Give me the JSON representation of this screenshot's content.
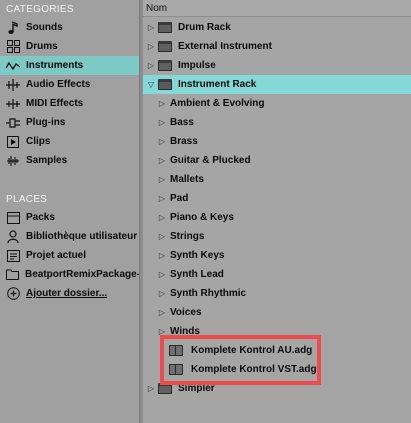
{
  "sidebar": {
    "categories_title": "CATEGORIES",
    "categories": [
      {
        "label": "Sounds",
        "icon": "note-icon"
      },
      {
        "label": "Drums",
        "icon": "grid-icon"
      },
      {
        "label": "Instruments",
        "icon": "wave-icon",
        "selected": true
      },
      {
        "label": "Audio Effects",
        "icon": "audio-effect-icon"
      },
      {
        "label": "MIDI Effects",
        "icon": "midi-effect-icon"
      },
      {
        "label": "Plug-ins",
        "icon": "plug-icon"
      },
      {
        "label": "Clips",
        "icon": "clip-icon"
      },
      {
        "label": "Samples",
        "icon": "sample-wave-icon"
      }
    ],
    "places_title": "PLACES",
    "places": [
      {
        "label": "Packs",
        "icon": "box-icon"
      },
      {
        "label": "Bibliothèque utilisateur",
        "icon": "user-icon"
      },
      {
        "label": "Projet actuel",
        "icon": "project-icon"
      },
      {
        "label": "BeatportRemixPackage-",
        "icon": "folder-icon"
      },
      {
        "label": "Ajouter dossier...",
        "icon": "add-icon"
      }
    ]
  },
  "browser": {
    "column_header": "Nom",
    "items": [
      {
        "label": "Drum Rack",
        "level": 0,
        "type": "folder",
        "expanded": false
      },
      {
        "label": "External Instrument",
        "level": 0,
        "type": "folder",
        "expanded": false
      },
      {
        "label": "Impulse",
        "level": 0,
        "type": "folder",
        "expanded": false
      },
      {
        "label": "Instrument Rack",
        "level": 0,
        "type": "folder",
        "expanded": true,
        "selected": true
      },
      {
        "label": "Ambient & Evolving",
        "level": 1,
        "type": "category"
      },
      {
        "label": "Bass",
        "level": 1,
        "type": "category"
      },
      {
        "label": "Brass",
        "level": 1,
        "type": "category"
      },
      {
        "label": "Guitar & Plucked",
        "level": 1,
        "type": "category"
      },
      {
        "label": "Mallets",
        "level": 1,
        "type": "category"
      },
      {
        "label": "Pad",
        "level": 1,
        "type": "category"
      },
      {
        "label": "Piano & Keys",
        "level": 1,
        "type": "category"
      },
      {
        "label": "Strings",
        "level": 1,
        "type": "category"
      },
      {
        "label": "Synth Keys",
        "level": 1,
        "type": "category"
      },
      {
        "label": "Synth Lead",
        "level": 1,
        "type": "category"
      },
      {
        "label": "Synth Rhythmic",
        "level": 1,
        "type": "category"
      },
      {
        "label": "Voices",
        "level": 1,
        "type": "category"
      },
      {
        "label": "Winds",
        "level": 1,
        "type": "category"
      },
      {
        "label": "Komplete Kontrol AU.adg",
        "level": 1,
        "type": "preset"
      },
      {
        "label": "Komplete Kontrol VST.adg",
        "level": 1,
        "type": "preset"
      },
      {
        "label": "Simpler",
        "level": 0,
        "type": "folder",
        "expanded": false
      }
    ]
  },
  "colors": {
    "selection": "#84d9d8",
    "highlight_border": "#ee4c4c"
  }
}
